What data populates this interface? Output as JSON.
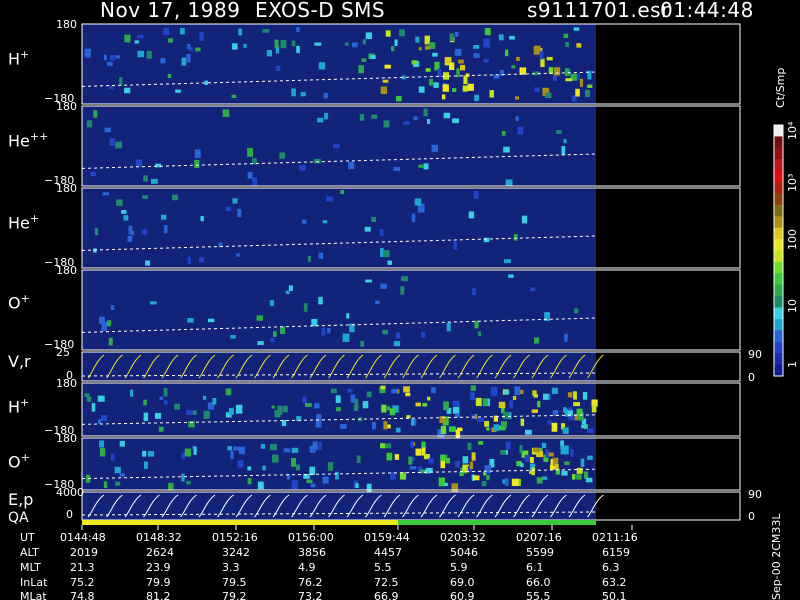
{
  "header": {
    "date": "Nov 17, 1989",
    "instrument": "EXOS-D SMS",
    "file": "s9111701.esr",
    "time": "01:44:48"
  },
  "panels": [
    {
      "label": "H",
      "charge": "+",
      "ytop": "180",
      "ybottom": "−180"
    },
    {
      "label": "He",
      "charge": "++",
      "ytop": "180",
      "ybottom": "−180"
    },
    {
      "label": "He",
      "charge": "+",
      "ytop": "180",
      "ybottom": "−180"
    },
    {
      "label": "O",
      "charge": "+",
      "ytop": "180",
      "ybottom": "−180"
    },
    {
      "label": "V,r",
      "charge": "",
      "ytop": "25",
      "ybottom": "0",
      "rtop": "90",
      "rbottom": "0"
    },
    {
      "label": "H",
      "charge": "+",
      "ytop": "180",
      "ybottom": "−180"
    },
    {
      "label": "O",
      "charge": "+",
      "ytop": "180",
      "ybottom": "−180"
    },
    {
      "label": "E,p",
      "charge": "",
      "ytop": "4000",
      "ybottom": "0",
      "rtop": "90",
      "rbottom": "0"
    }
  ],
  "qa_label": "QA",
  "colorbar": {
    "unit": "Ct/Smp",
    "labels": [
      "1",
      "10",
      "100",
      "10³",
      "10⁴"
    ],
    "colors": [
      "#101a8c",
      "#1a2ca8",
      "#2244c8",
      "#2a64d8",
      "#1ea8d0",
      "#38d0e0",
      "#1f8a6a",
      "#2faa4a",
      "#3cc83c",
      "#6edc2c",
      "#c8e41c",
      "#f0e81e",
      "#d8c818",
      "#a89018",
      "#786c14",
      "#8c4010",
      "#b02010",
      "#e01010",
      "#c01818",
      "#901010",
      "#701010",
      "#f0f0f0"
    ]
  },
  "watermark": "Sep-00 2CM33L",
  "table": {
    "rows": [
      {
        "name": "UT",
        "values": [
          "0144:48",
          "0148:32",
          "0152:16",
          "0156:00",
          "0159:44",
          "0203:32",
          "0207:16",
          "0211:16"
        ]
      },
      {
        "name": "ALT",
        "values": [
          "2019",
          "2624",
          "3242",
          "3856",
          "4457",
          "5046",
          "5599",
          "6159"
        ]
      },
      {
        "name": "MLT",
        "values": [
          "21.3",
          "23.9",
          "3.3",
          "4.9",
          "5.5",
          "5.9",
          "6.1",
          "6.3"
        ]
      },
      {
        "name": "InLat",
        "values": [
          "75.2",
          "79.9",
          "79.5",
          "76.2",
          "72.5",
          "69.0",
          "66.0",
          "63.2"
        ]
      },
      {
        "name": "MLat",
        "values": [
          "74.8",
          "81.2",
          "79.2",
          "73.2",
          "66.9",
          "60.9",
          "55.5",
          "50.1"
        ]
      }
    ]
  },
  "chart_data": {
    "type": "heatmap",
    "x_axis": "UT",
    "y_range": [
      -180,
      180
    ],
    "colorbar_scale": "log",
    "colorbar_range": [
      1,
      10000
    ],
    "colorbar_unit": "Ct/Smp",
    "series": [
      {
        "name": "H+",
        "ylim": [
          -180,
          180
        ]
      },
      {
        "name": "He++",
        "ylim": [
          -180,
          180
        ]
      },
      {
        "name": "He+",
        "ylim": [
          -180,
          180
        ]
      },
      {
        "name": "O+",
        "ylim": [
          -180,
          180
        ]
      },
      {
        "name": "V,r",
        "ylim": [
          0,
          25
        ],
        "right_ylim": [
          0,
          90
        ]
      },
      {
        "name": "H+",
        "ylim": [
          -180,
          180
        ]
      },
      {
        "name": "O+",
        "ylim": [
          -180,
          180
        ]
      },
      {
        "name": "E,p",
        "ylim": [
          0,
          4000
        ],
        "right_ylim": [
          0,
          90
        ]
      }
    ],
    "qa": [
      {
        "from": "0144:48",
        "to": "0159:44",
        "color": "#f0e81e"
      },
      {
        "from": "0159:44",
        "to": "0210:00",
        "color": "#3cc83c"
      }
    ],
    "data_end_ut": "0210:00"
  },
  "colors": {
    "frame": "#ffffff",
    "background": "#000000",
    "panel_fill": "#13237a",
    "trace_yellow": "#f0e81e",
    "qa_yellow": "#f0e81e",
    "qa_green": "#3cc83c"
  }
}
